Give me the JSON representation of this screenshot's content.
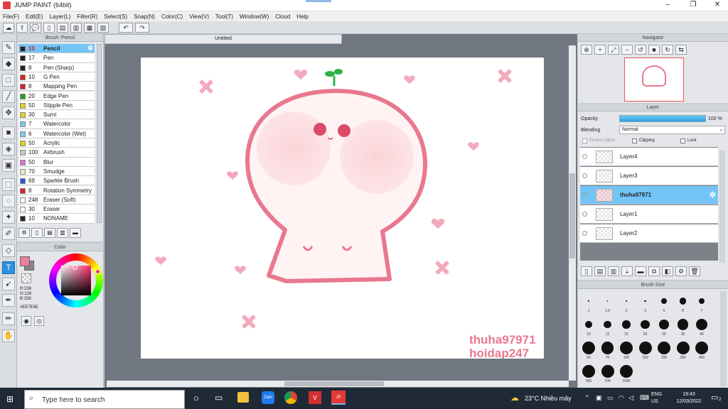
{
  "window": {
    "title": "JUMP PAINT (64bit)"
  },
  "menu": [
    "File(F)",
    "Edit(E)",
    "Layer(L)",
    "Filter(R)",
    "Select(S)",
    "Snap(N)",
    "Color(C)",
    "View(V)",
    "Tool(T)",
    "Window(W)",
    "Cloud",
    "Help"
  ],
  "brush_panel": {
    "title": "Brush: Pencil",
    "items": [
      {
        "size": "10",
        "name": "Pencil",
        "color": "#222222",
        "selected": true
      },
      {
        "size": "17",
        "name": "Pen",
        "color": "#222222"
      },
      {
        "size": "8",
        "name": "Pen (Sharp)",
        "color": "#222222"
      },
      {
        "size": "10",
        "name": "G Pen",
        "color": "#e02020"
      },
      {
        "size": "8",
        "name": "Mapping Pen",
        "color": "#e02020"
      },
      {
        "size": "20",
        "name": "Edge Pen",
        "color": "#20a020"
      },
      {
        "size": "50",
        "name": "Stipple Pen",
        "color": "#e0d020"
      },
      {
        "size": "30",
        "name": "Sumi",
        "color": "#e0d020"
      },
      {
        "size": "7",
        "name": "Watercolor",
        "color": "#7ac8f0"
      },
      {
        "size": "6",
        "name": "Watercolor (Wet)",
        "color": "#7ac8f0"
      },
      {
        "size": "50",
        "name": "Acrylic",
        "color": "#e0d020"
      },
      {
        "size": "100",
        "name": "Airbrush",
        "color": "#c8c8c8"
      },
      {
        "size": "50",
        "name": "Blur",
        "color": "#e070e0"
      },
      {
        "size": "70",
        "name": "Smudge",
        "color": "#f0e8c8"
      },
      {
        "size": "69",
        "name": "Sparkle Brush",
        "color": "#3050e0"
      },
      {
        "size": "8",
        "name": "Rotation Symmetry",
        "color": "#e02020"
      },
      {
        "size": "248",
        "name": "Eraser (Soft)",
        "color": "#ffffff"
      },
      {
        "size": "30",
        "name": "Eraser",
        "color": "#ffffff"
      },
      {
        "size": "10",
        "name": "NONAME",
        "color": "#222222"
      }
    ]
  },
  "color_panel": {
    "title": "Color",
    "r": "R:238",
    "g": "G:126",
    "b": "B:158",
    "hex": "#EE7E9E"
  },
  "document": {
    "tab_title": "Untitled",
    "watermark_line1": "thuha97971",
    "watermark_line2": "hoidap247"
  },
  "navigator": {
    "title": "Navigator"
  },
  "layer_panel": {
    "title": "Layer",
    "opacity_label": "Opacity",
    "opacity_value": "100 %",
    "blending_label": "Blending",
    "blending_value": "Normal",
    "protect_alpha": "Protect Alpha",
    "clipping": "Clipping",
    "lock": "Lock",
    "layers": [
      "Layer4",
      "Layer3",
      "thuha97971",
      "Layer1",
      "Layer2"
    ]
  },
  "brush_size": {
    "title": "Brush Size",
    "sizes": [
      "1",
      "1.6",
      "2",
      "3",
      "6",
      "8",
      "7",
      "10",
      "12",
      "15",
      "20",
      "25",
      "30",
      "40",
      "50",
      "70",
      "100",
      "150",
      "200",
      "300",
      "400",
      "500",
      "700",
      "1000"
    ]
  },
  "taskbar": {
    "search_placeholder": "Type here to search",
    "weather": "23°C  Nhiều mây",
    "lang1": "ENG",
    "lang2": "US",
    "time": "19:43",
    "date": "12/03/2022",
    "notif_count": "2"
  },
  "colors": {
    "accent_pink": "#EE7E9E",
    "selection_blue": "#73c5f7"
  }
}
